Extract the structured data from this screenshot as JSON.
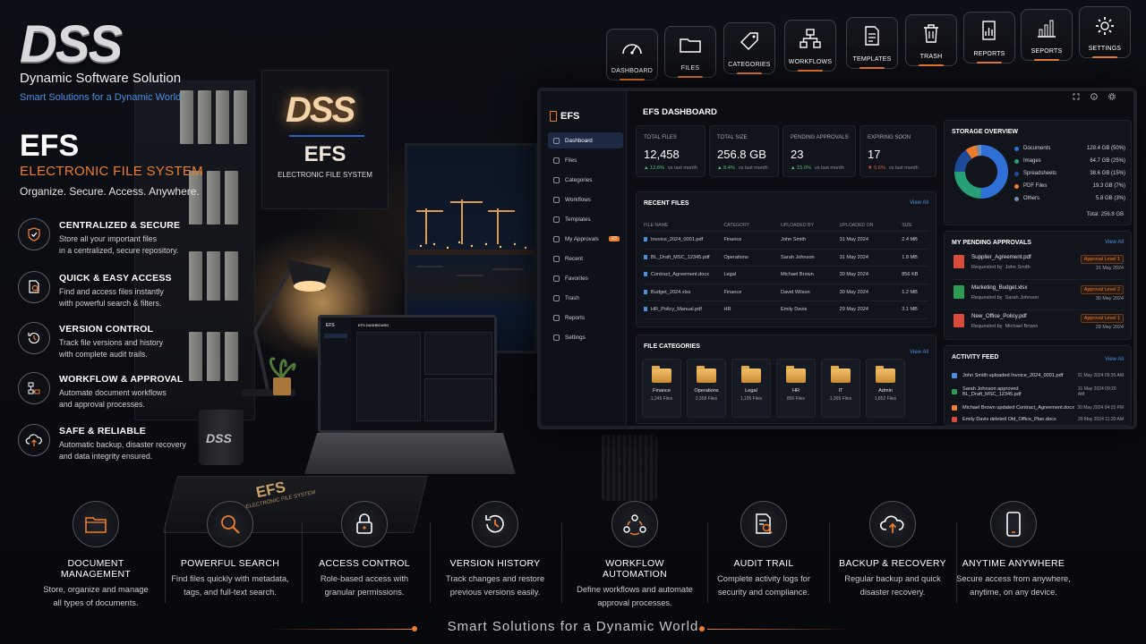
{
  "brand": {
    "logo": "DSS",
    "name": "Dynamic Software Solution",
    "tagline": "Smart Solutions for a Dynamic World"
  },
  "product": {
    "title": "EFS",
    "subtitle": "ELECTRONIC FILE SYSTEM",
    "tagline": "Organize. Secure. Access. Anywhere."
  },
  "wall_sign": {
    "logo": "DSS",
    "title": "EFS",
    "subtitle": "ELECTRONIC FILE SYSTEM"
  },
  "features": [
    {
      "title": "CENTRALIZED & SECURE",
      "desc1": "Store all your important files",
      "desc2": "in a centralized, secure repository.",
      "icon": "shield-icon"
    },
    {
      "title": "QUICK & EASY ACCESS",
      "desc1": "Find and access files instantly",
      "desc2": "with powerful search & filters.",
      "icon": "search-document-icon"
    },
    {
      "title": "VERSION CONTROL",
      "desc1": "Track file versions and history",
      "desc2": "with complete audit trails.",
      "icon": "history-icon"
    },
    {
      "title": "WORKFLOW & APPROVAL",
      "desc1": "Automate document workflows",
      "desc2": "and approval processes.",
      "icon": "workflow-icon"
    },
    {
      "title": "SAFE & RELIABLE",
      "desc1": "Automatic backup, disaster recovery",
      "desc2": "and data integrity ensured.",
      "icon": "cloud-upload-icon"
    }
  ],
  "toolbar": [
    "DASHBOARD",
    "FILES",
    "CATEGORIES",
    "WORKFLOWS",
    "TEMPLATES",
    "TRASH",
    "REPORTS",
    "SEPORTS",
    "SETTINGS"
  ],
  "app": {
    "name": "EFS",
    "nav": [
      {
        "label": "Dashboard"
      },
      {
        "label": "Files"
      },
      {
        "label": "Categories"
      },
      {
        "label": "Workflows"
      },
      {
        "label": "Templates"
      },
      {
        "label": "My Approvals",
        "badge": "23"
      },
      {
        "label": "Recent"
      },
      {
        "label": "Favorites"
      },
      {
        "label": "Trash"
      },
      {
        "label": "Reports"
      },
      {
        "label": "Settings"
      }
    ],
    "dashboard_title": "EFS DASHBOARD",
    "stats": [
      {
        "label": "TOTAL FILES",
        "value": "12,458",
        "change": "12.6%",
        "note": "vs last month",
        "trend": "up"
      },
      {
        "label": "TOTAL SIZE",
        "value": "256.8 GB",
        "change": "8.4%",
        "note": "vs last month",
        "trend": "up"
      },
      {
        "label": "PENDING APPROVALS",
        "value": "23",
        "change": "15.0%",
        "note": "vs last month",
        "trend": "up"
      },
      {
        "label": "EXPIRING SOON",
        "value": "17",
        "change": "5.6%",
        "note": "vs last month",
        "trend": "down"
      }
    ],
    "recent_files": {
      "title": "RECENT FILES",
      "view_all": "View All",
      "headers": [
        "FILE NAME",
        "CATEGORY",
        "UPLOADED BY",
        "UPLOADED ON",
        "SIZE"
      ],
      "rows": [
        [
          "Invoice_2024_0001.pdf",
          "Finance",
          "John Smith",
          "31 May 2024",
          "2.4 MB"
        ],
        [
          "BL_Draft_MSC_12345.pdf",
          "Operations",
          "Sarah Johnson",
          "31 May 2024",
          "1.8 MB"
        ],
        [
          "Contract_Agreement.docx",
          "Legal",
          "Michael Brown",
          "30 May 2024",
          "856 KB"
        ],
        [
          "Budget_2024.xlsx",
          "Finance",
          "David Wilson",
          "30 May 2024",
          "1.2 MB"
        ],
        [
          "HR_Policy_Manual.pdf",
          "HR",
          "Emily Davis",
          "29 May 2024",
          "3.1 MB"
        ]
      ]
    },
    "categories": {
      "title": "FILE CATEGORIES",
      "view_all": "View All",
      "items": [
        {
          "name": "Finance",
          "count": "1,245 Files"
        },
        {
          "name": "Operations",
          "count": "2,358 Files"
        },
        {
          "name": "Legal",
          "count": "1,105 Files"
        },
        {
          "name": "HR",
          "count": "856 Files"
        },
        {
          "name": "IT",
          "count": "1,365 Files"
        },
        {
          "name": "Admin",
          "count": "1,852 Files"
        }
      ]
    },
    "storage": {
      "title": "STORAGE OVERVIEW",
      "total": "Total: 256.8 GB",
      "items": [
        {
          "name": "Documents",
          "value": "128.4 GB (50%)",
          "pct": 50,
          "color": "#2f6fd6"
        },
        {
          "name": "Images",
          "value": "64.7 GB (25%)",
          "pct": 25,
          "color": "#27a07a"
        },
        {
          "name": "Spreadsheets",
          "value": "38.6 GB (15%)",
          "pct": 15,
          "color": "#1f4a9a"
        },
        {
          "name": "PDF Files",
          "value": "19.3 GB (7%)",
          "pct": 7,
          "color": "#ef7c2d"
        },
        {
          "name": "Others",
          "value": "5.8 GB (3%)",
          "pct": 3,
          "color": "#6f8fb8"
        }
      ]
    },
    "approvals": {
      "title": "MY PENDING APPROVALS",
      "view_all": "View All",
      "items": [
        {
          "name": "Supplier_Agreement.pdf",
          "req": "Requested by",
          "by": "John Smith",
          "level": "Approval Level 1",
          "date": "31 May 2024",
          "color": "#d94a3a"
        },
        {
          "name": "Marketing_Budget.xlsx",
          "req": "Requested by",
          "by": "Sarah Johnson",
          "level": "Approval Level 2",
          "date": "30 May 2024",
          "color": "#2e9b52"
        },
        {
          "name": "New_Office_Policy.pdf",
          "req": "Requested by",
          "by": "Michael Brown",
          "level": "Approval Level 1",
          "date": "29 May 2024",
          "color": "#d94a3a"
        }
      ]
    },
    "activity": {
      "title": "ACTIVITY FEED",
      "view_all": "View All",
      "items": [
        {
          "text": "John Smith uploaded Invoice_2024_0001.pdf",
          "time": "31 May 2024 09:35 AM",
          "color": "#4a8fe0"
        },
        {
          "text": "Sarah Johnson approved BL_Draft_MSC_12345.pdf",
          "time": "31 May 2024 09:20 AM",
          "color": "#2e9b52"
        },
        {
          "text": "Michael Brown updated Contract_Agreement.docx",
          "time": "30 May 2024 04:15 PM",
          "color": "#ef7c2d"
        },
        {
          "text": "Emily Davis deleted Old_Office_Plan.docx",
          "time": "29 May 2024 11:20 AM",
          "color": "#d94a3a"
        }
      ]
    }
  },
  "laptop": {
    "app_name": "EFS",
    "title": "EFS DASHBOARD"
  },
  "mug_logo": "DSS",
  "book": {
    "title": "EFS",
    "subtitle": "ELECTRONIC FILE SYSTEM"
  },
  "bottom_features": [
    {
      "title": "DOCUMENT MANAGEMENT",
      "line1": "Store, organize and manage",
      "line2": "all types of documents.",
      "icon": "folder-icon"
    },
    {
      "title": "POWERFUL SEARCH",
      "line1": "Find files quickly with metadata,",
      "line2": "tags, and full-text search.",
      "icon": "magnifier-icon"
    },
    {
      "title": "ACCESS CONTROL",
      "line1": "Role-based access with",
      "line2": "granular permissions.",
      "icon": "lock-icon"
    },
    {
      "title": "VERSION HISTORY",
      "line1": "Track changes and restore",
      "line2": "previous versions easily.",
      "icon": "clock-history-icon"
    },
    {
      "title": "WORKFLOW AUTOMATION",
      "line1": "Define workflows and automate",
      "line2": "approval processes.",
      "icon": "team-workflow-icon"
    },
    {
      "title": "AUDIT TRAIL",
      "line1": "Complete activity logs for",
      "line2": "security and compliance.",
      "icon": "audit-document-icon"
    },
    {
      "title": "BACKUP & RECOVERY",
      "line1": "Regular backup and quick",
      "line2": "disaster recovery.",
      "icon": "cloud-backup-icon"
    },
    {
      "title": "ANYTIME ANYWHERE",
      "line1": "Secure access from anywhere,",
      "line2": "anytime, on any device.",
      "icon": "mobile-icon"
    }
  ],
  "footer": "Smart Solutions for a Dynamic World",
  "colors": {
    "accent": "#ef7c2d",
    "link": "#4a8fe0",
    "background": "#0a0c11"
  }
}
